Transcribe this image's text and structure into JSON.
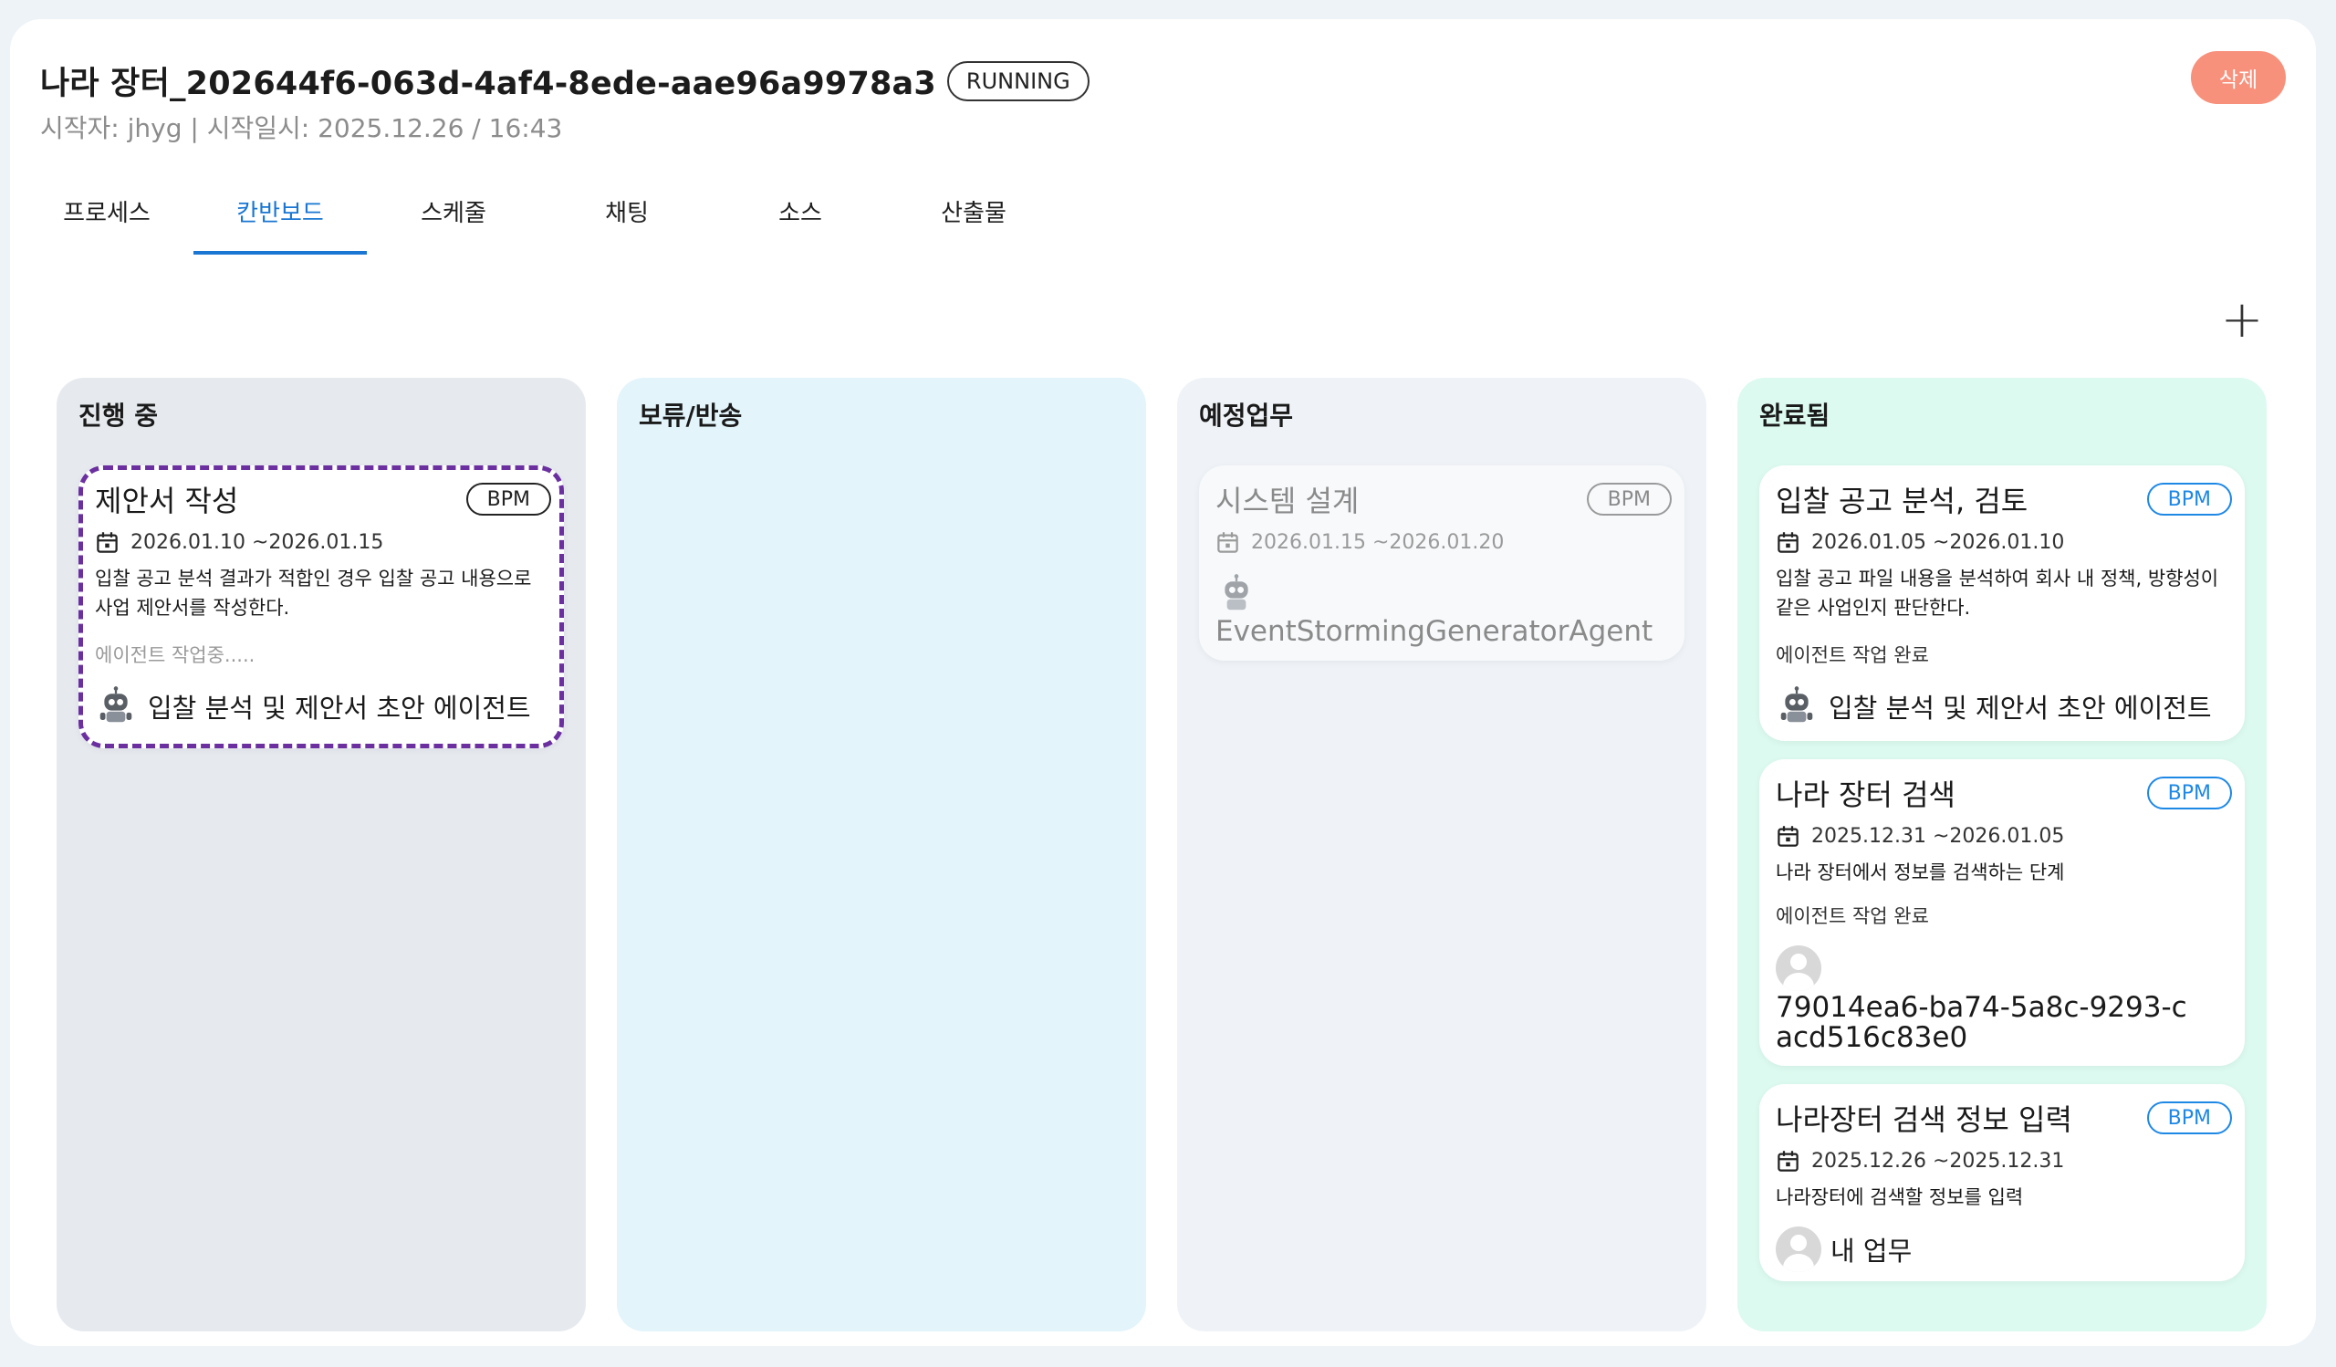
{
  "header": {
    "title": "나라 장터_202644f6-063d-4af4-8ede-aae96a9978a3",
    "status": "RUNNING",
    "subtitle": "시작자: jhyg | 시작일시: 2025.12.26 / 16:43",
    "delete_label": "삭제"
  },
  "tabs": [
    {
      "label": "프로세스"
    },
    {
      "label": "칸반보드",
      "active": true
    },
    {
      "label": "스케줄"
    },
    {
      "label": "채팅"
    },
    {
      "label": "소스"
    },
    {
      "label": "산출물"
    }
  ],
  "add_button": "+",
  "columns": [
    {
      "title": "진행 중",
      "color": "#e6eaef",
      "cards": [
        {
          "title": "제안서 작성",
          "badge": "BPM",
          "dates": "2026.01.10 ~2026.01.15",
          "description": "입찰 공고 분석 결과가 적합인 경우 입찰 공고 내용으로 사업 제안서를 작성한다.",
          "agent_status": "에이전트 작업중.....",
          "assignee": "입찰 분석 및 제안서 초안 에이전트",
          "assignee_icon": "robot-icon"
        }
      ]
    },
    {
      "title": "보류/반송",
      "color": "#e3f4fb",
      "cards": []
    },
    {
      "title": "예정업무",
      "color": "#eff3f7",
      "cards": [
        {
          "title": "시스템 설계",
          "badge": "BPM",
          "dates": "2026.01.15 ~2026.01.20",
          "assignee": "EventStormingGeneratorAgent",
          "assignee_icon": "robot-icon"
        }
      ]
    },
    {
      "title": "완료됨",
      "color": "#dcfaef",
      "cards": [
        {
          "title": "입찰 공고 분석, 검토",
          "badge": "BPM",
          "dates": "2026.01.05 ~2026.01.10",
          "description": "입찰 공고 파일 내용을 분석하여 회사 내 정책, 방향성이 같은 사업인지 판단한다.",
          "agent_status": "에이전트 작업 완료",
          "assignee": "입찰 분석 및 제안서 초안 에이전트",
          "assignee_icon": "robot-icon"
        },
        {
          "title": "나라 장터 검색",
          "badge": "BPM",
          "dates": "2025.12.31 ~2026.01.05",
          "description": "나라 장터에서 정보를 검색하는 단계",
          "agent_status": "에이전트 작업 완료",
          "assignee": "79014ea6-ba74-5a8c-9293-cacd516c83e0",
          "assignee_icon": "user-avatar-icon"
        },
        {
          "title": "나라장터 검색 정보 입력",
          "badge": "BPM",
          "dates": "2025.12.26 ~2025.12.31",
          "description": "나라장터에 검색할 정보를 입력",
          "assignee": "내 업무",
          "assignee_icon": "user-avatar-icon"
        }
      ]
    }
  ],
  "colors": {
    "accent": "#1976d2",
    "delete": "#f7917c",
    "active_border": "#6b2fa0"
  }
}
